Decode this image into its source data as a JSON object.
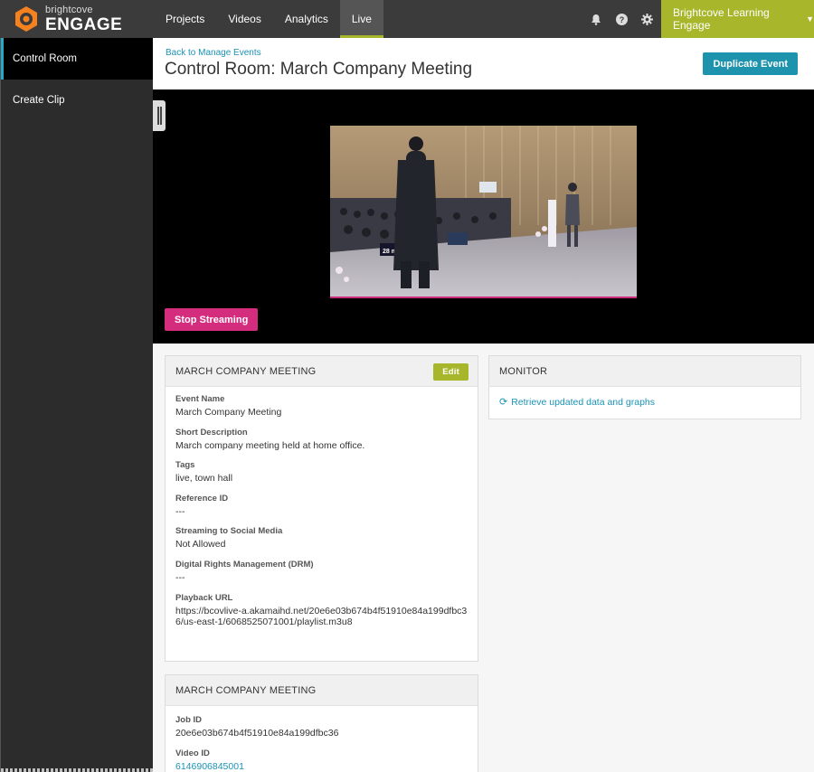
{
  "brand": {
    "small": "brightcove",
    "big": "ENGAGE",
    "accent": "#f5821f"
  },
  "nav": {
    "items": [
      {
        "label": "Projects"
      },
      {
        "label": "Videos"
      },
      {
        "label": "Analytics"
      },
      {
        "label": "Live"
      }
    ],
    "active": "Live"
  },
  "top_icons": [
    "bell-icon",
    "help-icon",
    "gear-icon"
  ],
  "account": {
    "label": "Brightcove Learning Engage",
    "caret": "▼"
  },
  "sidebar": {
    "items": [
      {
        "label": "Control Room"
      },
      {
        "label": "Create Clip"
      }
    ],
    "active": "Control Room"
  },
  "header": {
    "back_link": "Back to Manage Events",
    "title": "Control Room: March Company Meeting",
    "duplicate_label": "Duplicate Event"
  },
  "player": {
    "stop_label": "Stop Streaming",
    "overlay_text": "28 mi"
  },
  "details_panel": {
    "title": "MARCH COMPANY MEETING",
    "edit_label": "Edit",
    "fields": [
      {
        "label": "Event Name",
        "value": "March Company Meeting"
      },
      {
        "label": "Short Description",
        "value": "March company meeting held at home office."
      },
      {
        "label": "Tags",
        "value": "live, town hall"
      },
      {
        "label": "Reference ID",
        "value": "---"
      },
      {
        "label": "Streaming to Social Media",
        "value": "Not Allowed"
      },
      {
        "label": "Digital Rights Management (DRM)",
        "value": "---"
      },
      {
        "label": "Playback URL",
        "value": "https://bcovlive-a.akamaihd.net/20e6e03b674b4f51910e84a199dfbc36/us-east-1/6068525071001/playlist.m3u8"
      }
    ]
  },
  "job_panel": {
    "title": "MARCH COMPANY MEETING",
    "fields": [
      {
        "label": "Job ID",
        "value": "20e6e03b674b4f51910e84a199dfbc36"
      },
      {
        "label": "Video ID",
        "value": "6146906845001"
      }
    ]
  },
  "monitor_panel": {
    "title": "MONITOR",
    "link_label": "Retrieve updated data and graphs"
  },
  "colors": {
    "topbar": "#3b3b3b",
    "accent_green": "#a7b62b",
    "teal": "#1d93ad",
    "pink": "#d52d7e",
    "link": "#1a93b5"
  }
}
